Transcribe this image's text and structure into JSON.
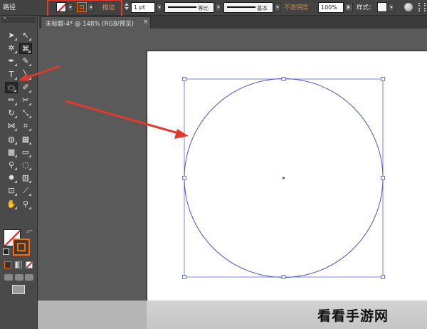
{
  "control_bar": {
    "path_label": "路径",
    "stroke_label": "描边",
    "stroke_weight": "1 pt",
    "profile_label": "等比",
    "brush_label": "基本",
    "opacity_label": "不透明度",
    "opacity_value": "100%",
    "style_label": "样式："
  },
  "document_tab": {
    "title": "未标题-4* @ 148% (RGB/预览)",
    "close_glyph": "×"
  },
  "tools": [
    {
      "name": "selection-tool",
      "glyph": "➤"
    },
    {
      "name": "direct-selection-tool",
      "glyph": "↖"
    },
    {
      "name": "magic-wand-tool",
      "glyph": "✲"
    },
    {
      "name": "lasso-tool",
      "glyph": "⌘"
    },
    {
      "name": "pen-tool",
      "glyph": "✒"
    },
    {
      "name": "curvature-tool",
      "glyph": "✎"
    },
    {
      "name": "type-tool",
      "glyph": "T"
    },
    {
      "name": "line-tool",
      "glyph": "╲"
    },
    {
      "name": "ellipse-tool",
      "glyph": "⬭"
    },
    {
      "name": "paintbrush-tool",
      "glyph": "✐"
    },
    {
      "name": "pencil-tool",
      "glyph": "✏"
    },
    {
      "name": "scissors-tool",
      "glyph": "✂"
    },
    {
      "name": "rotate-tool",
      "glyph": "↻"
    },
    {
      "name": "scale-tool",
      "glyph": "⤡"
    },
    {
      "name": "width-tool",
      "glyph": "⋈"
    },
    {
      "name": "free-transform-tool",
      "glyph": "⌗"
    },
    {
      "name": "shape-builder-tool",
      "glyph": "◍"
    },
    {
      "name": "perspective-grid-tool",
      "glyph": "▦"
    },
    {
      "name": "mesh-tool",
      "glyph": "▩"
    },
    {
      "name": "gradient-tool",
      "glyph": "▭"
    },
    {
      "name": "eyedropper-tool",
      "glyph": "⚲"
    },
    {
      "name": "blend-tool",
      "glyph": "◌"
    },
    {
      "name": "symbol-sprayer-tool",
      "glyph": "✹"
    },
    {
      "name": "column-graph-tool",
      "glyph": "▥"
    },
    {
      "name": "artboard-tool",
      "glyph": "⊡"
    },
    {
      "name": "slice-tool",
      "glyph": "⟋"
    },
    {
      "name": "hand-tool",
      "glyph": "✋"
    },
    {
      "name": "zoom-tool",
      "glyph": "⚲"
    }
  ],
  "colors": {
    "accent_orange": "#ff6a00",
    "annotation_red": "#e03a2e",
    "path_blue": "#4a55c8"
  },
  "watermark": "看看手游网"
}
